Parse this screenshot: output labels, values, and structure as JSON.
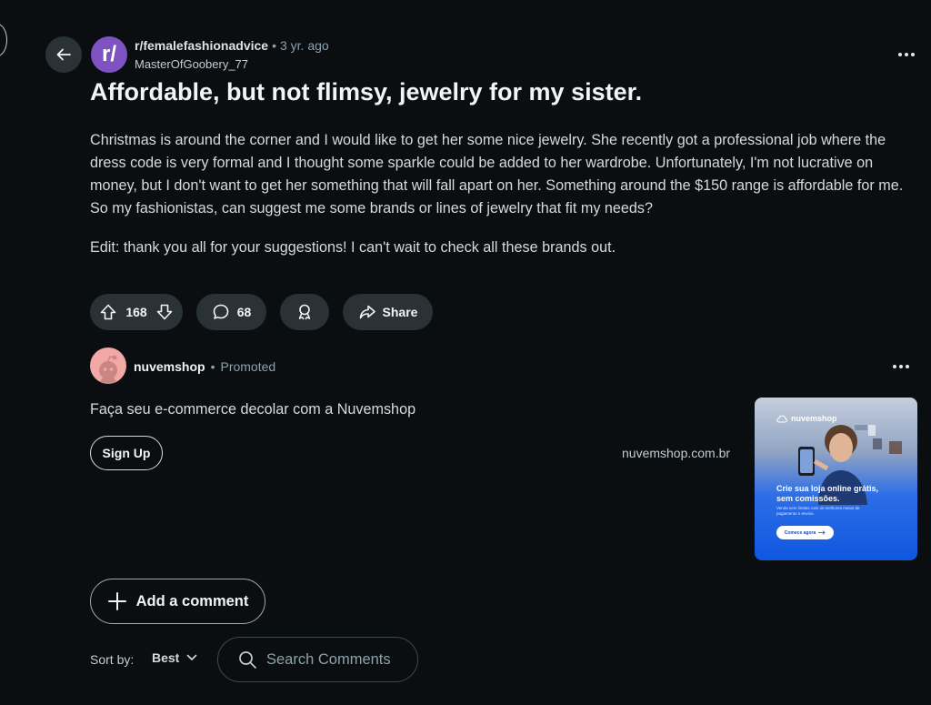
{
  "post": {
    "subreddit": "r/femalefashionadvice",
    "separator": "•",
    "time_ago": "3 yr. ago",
    "author": "MasterOfGoobery_77",
    "avatar_text": "r/",
    "title": "Affordable, but not flimsy, jewelry for my sister.",
    "body": "Christmas is around the corner and I would like to get her some nice jewelry. She recently got a professional job where the dress code is very formal and I thought some sparkle could be added to her wardrobe. Unfortunately, I'm not lucrative on money, but I don't want to get her something that will fall apart on her. Something around the $150 range is affordable for me. So my fashionistas, can suggest me some brands or lines of jewelry that fit my needs?",
    "edit": "Edit: thank you all for your suggestions! I can't wait to check all these brands out."
  },
  "actions": {
    "upvotes": "168",
    "comments": "68",
    "share_label": "Share"
  },
  "ad": {
    "advertiser": "nuvemshop",
    "separator": "•",
    "promoted_label": "Promoted",
    "headline": "Faça seu e-commerce decolar com a Nuvemshop",
    "cta_label": "Sign Up",
    "domain": "nuvemshop.com.br",
    "image": {
      "logo_text": "nuvemshop",
      "headline": "Crie sua loja online grátis, sem comissões.",
      "subtext": "Venda sem limites com os melhores meios de pagamento e envios.",
      "button": "Comece agora"
    }
  },
  "comments_section": {
    "add_comment_label": "Add a comment",
    "sort_label": "Sort by:",
    "sort_value": "Best",
    "search_placeholder": "Search Comments"
  },
  "colors": {
    "background": "#0b0e11",
    "pill": "#2a3236",
    "subreddit_avatar": "#7e53c1",
    "ad_avatar": "#f4a8a6",
    "ad_blue": "#0f57e1"
  },
  "icons": [
    "back-arrow-icon",
    "overflow-menu-icon",
    "upvote-icon",
    "downvote-icon",
    "comment-icon",
    "award-icon",
    "share-icon",
    "plus-icon",
    "chevron-down-icon",
    "search-icon"
  ]
}
